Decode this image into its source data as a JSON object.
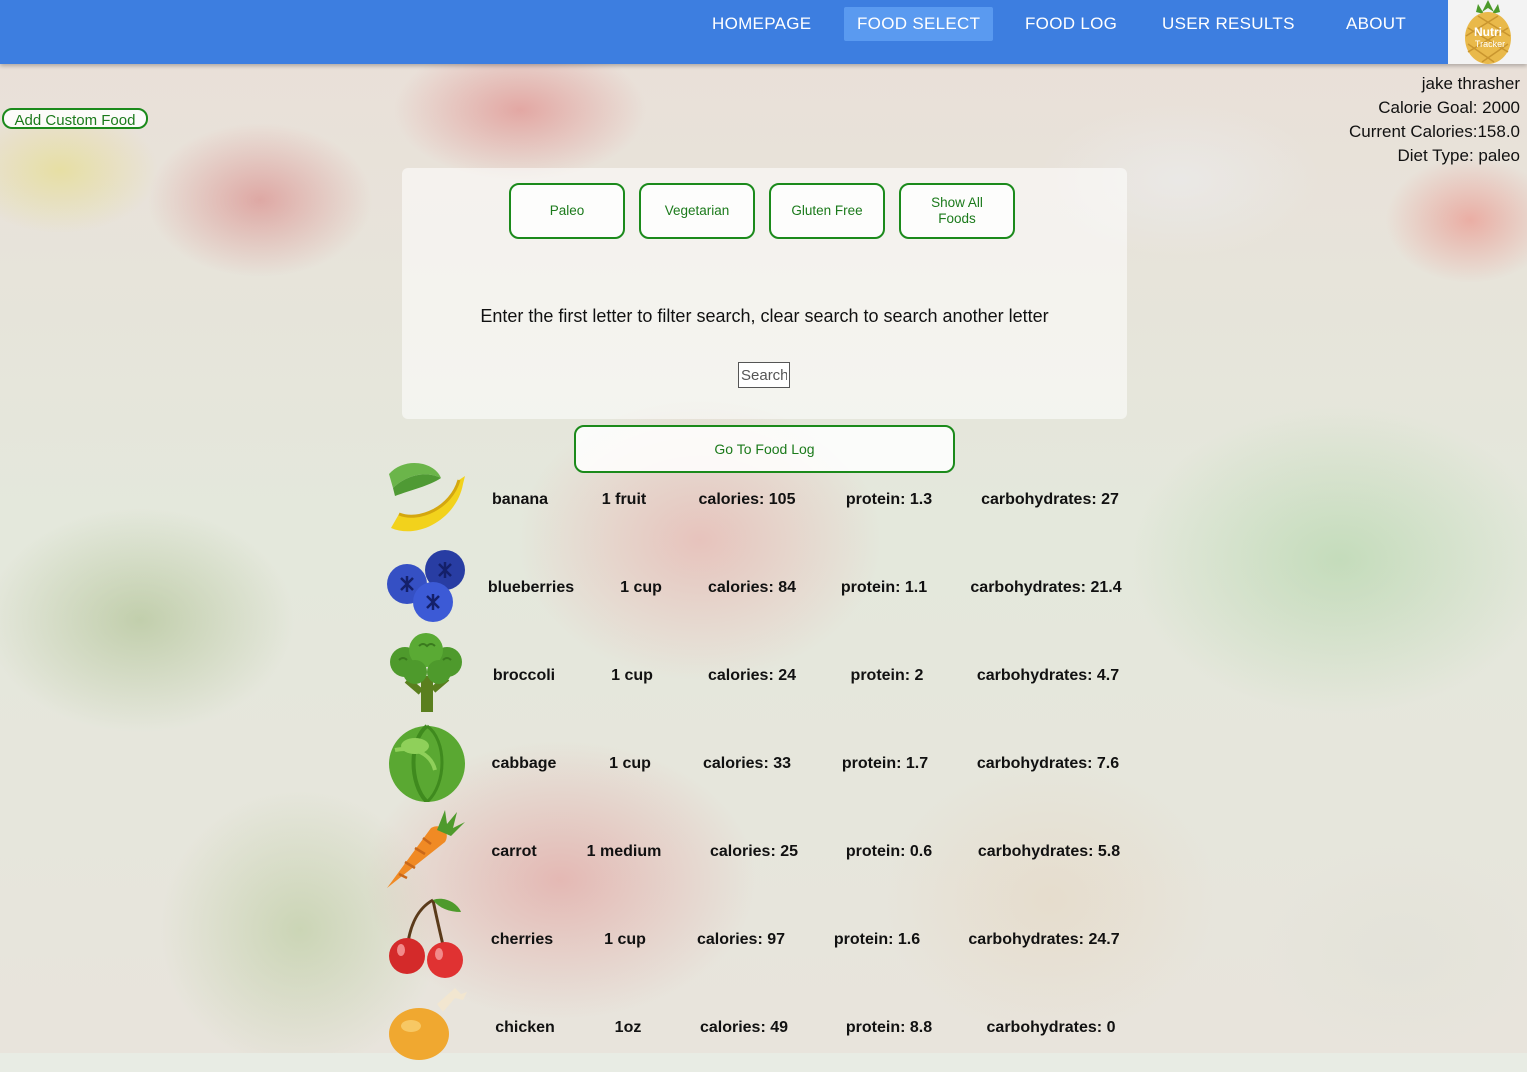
{
  "nav": {
    "items": [
      {
        "label": "HOMEPAGE"
      },
      {
        "label": "FOOD SELECT"
      },
      {
        "label": "FOOD LOG"
      },
      {
        "label": "USER RESULTS"
      },
      {
        "label": "ABOUT"
      }
    ],
    "active": "FOOD SELECT",
    "accent": "#3d7ee0"
  },
  "logo": {
    "line1": "Nutri",
    "line2": "Tracker"
  },
  "user": {
    "name": "jake thrasher",
    "calorie_goal": "Calorie Goal: 2000",
    "current_calories": "Current Calories:158.0",
    "diet_type": "Diet Type: paleo"
  },
  "add_custom_label": "Add Custom Food",
  "filters": [
    "Paleo",
    "Vegetarian",
    "Gluten Free",
    "Show All Foods"
  ],
  "instructions": "Enter the first letter to filter search, clear search to search another letter",
  "search": {
    "placeholder": "Search",
    "value": ""
  },
  "food_log_button": "Go To Food Log",
  "foods": [
    {
      "name": "banana",
      "serving": "1 fruit",
      "calories": "calories: 105",
      "protein": "protein: 1.3",
      "carbs": "carbohydrates: 27",
      "icon": "banana-icon"
    },
    {
      "name": "blueberries",
      "serving": "1 cup",
      "calories": "calories: 84",
      "protein": "protein: 1.1",
      "carbs": "carbohydrates: 21.4",
      "icon": "blueberries-icon"
    },
    {
      "name": "broccoli",
      "serving": "1 cup",
      "calories": "calories: 24",
      "protein": "protein: 2",
      "carbs": "carbohydrates: 4.7",
      "icon": "broccoli-icon"
    },
    {
      "name": "cabbage",
      "serving": "1 cup",
      "calories": "calories: 33",
      "protein": "protein: 1.7",
      "carbs": "carbohydrates: 7.6",
      "icon": "cabbage-icon"
    },
    {
      "name": "carrot",
      "serving": "1 medium",
      "calories": "calories: 25",
      "protein": "protein: 0.6",
      "carbs": "carbohydrates: 5.8",
      "icon": "carrot-icon"
    },
    {
      "name": "cherries",
      "serving": "1 cup",
      "calories": "calories: 97",
      "protein": "protein: 1.6",
      "carbs": "carbohydrates: 24.7",
      "icon": "cherries-icon"
    },
    {
      "name": "chicken",
      "serving": "1oz",
      "calories": "calories: 49",
      "protein": "protein: 8.8",
      "carbs": "carbohydrates: 0",
      "icon": "chicken-leg-icon"
    }
  ]
}
